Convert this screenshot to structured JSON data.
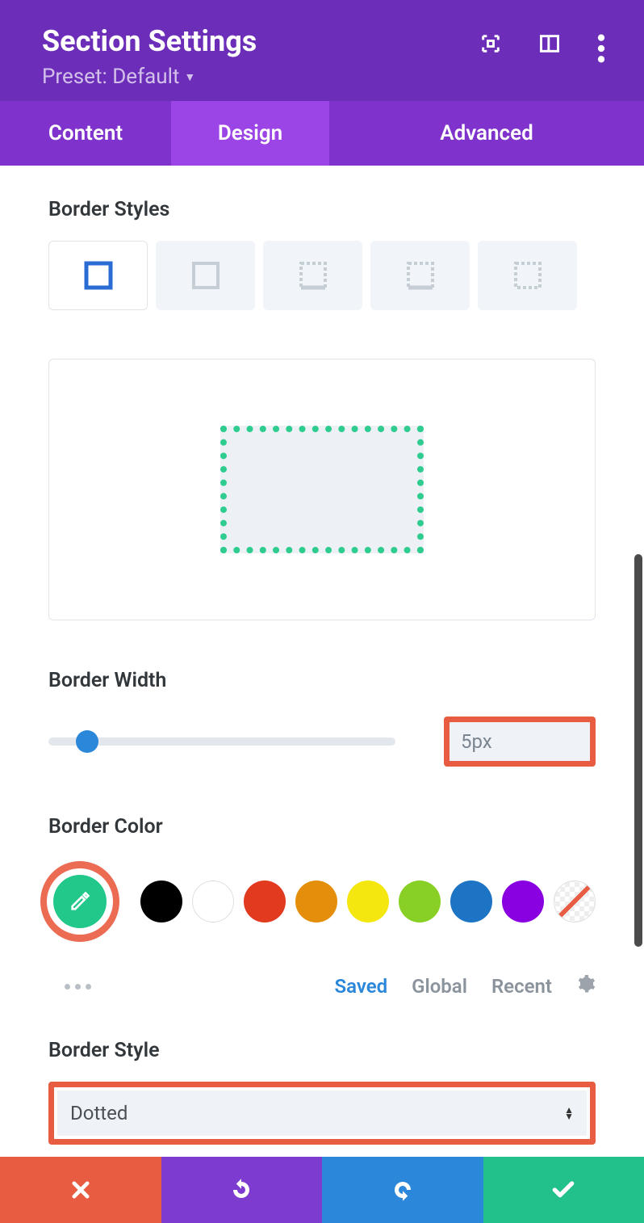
{
  "header": {
    "title": "Section Settings",
    "preset_label": "Preset: Default"
  },
  "tabs": {
    "content": "Content",
    "design": "Design",
    "advanced": "Advanced"
  },
  "border_styles": {
    "label": "Border Styles",
    "options": [
      "solid",
      "none",
      "dashed-tlr",
      "dashed-tlrb",
      "dashed-all"
    ]
  },
  "border_width": {
    "label": "Border Width",
    "value": "5px"
  },
  "border_color": {
    "label": "Border Color",
    "active": "#21c88a",
    "swatches": [
      "#000000",
      "#ffffff",
      "#e13a1e",
      "#e58e0b",
      "#f4e70f",
      "#89d026",
      "#1d74c4",
      "#8900e1",
      "transparent"
    ],
    "filters": {
      "saved": "Saved",
      "global": "Global",
      "recent": "Recent"
    }
  },
  "border_style": {
    "label": "Border Style",
    "value": "Dotted"
  }
}
